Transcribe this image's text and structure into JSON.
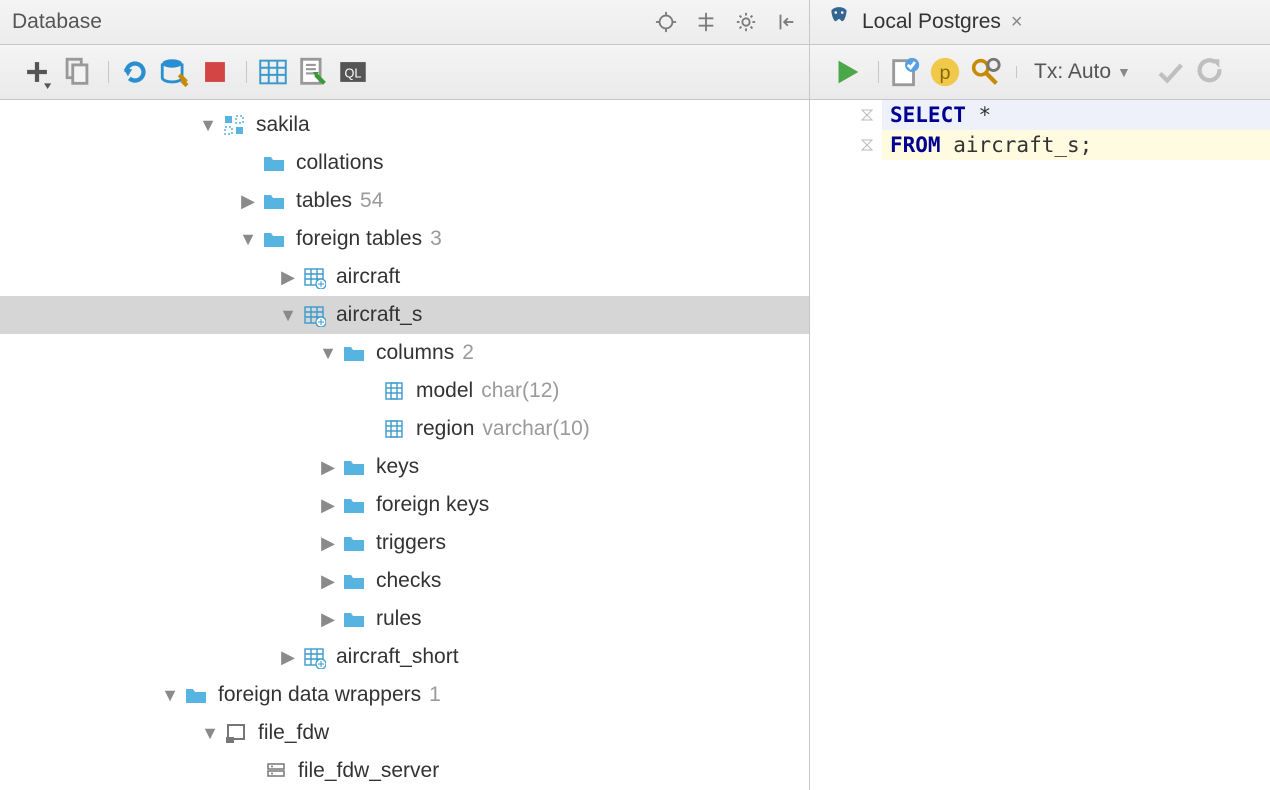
{
  "panel": {
    "title": "Database"
  },
  "tree": {
    "sakila": "sakila",
    "collations": "collations",
    "tables": "tables",
    "tables_count": "54",
    "foreign_tables": "foreign tables",
    "foreign_tables_count": "3",
    "aircraft": "aircraft",
    "aircraft_s": "aircraft_s",
    "columns": "columns",
    "columns_count": "2",
    "model": "model",
    "model_type": "char(12)",
    "region": "region",
    "region_type": "varchar(10)",
    "keys": "keys",
    "foreign_keys": "foreign keys",
    "triggers": "triggers",
    "checks": "checks",
    "rules": "rules",
    "aircraft_short": "aircraft_short",
    "fdw": "foreign data wrappers",
    "fdw_count": "1",
    "file_fdw": "file_fdw",
    "file_fdw_server": "file_fdw_server"
  },
  "tab": {
    "label": "Local Postgres"
  },
  "tx": {
    "label": "Tx: Auto"
  },
  "sql": {
    "line1_kw": "SELECT",
    "line1_rest": " *",
    "line2_kw": "FROM",
    "line2_rest": " aircraft_s;"
  }
}
